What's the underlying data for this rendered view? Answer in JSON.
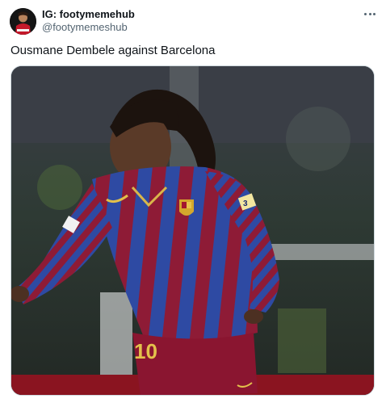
{
  "post": {
    "display_name": "IG: footymemehub",
    "handle": "@footymemeshub",
    "text": "Ousmane Dembele against Barcelona",
    "more_icon": "more-horizontal-icon"
  },
  "media": {
    "kit_number": "10",
    "armband_label": "3"
  },
  "colors": {
    "text_primary": "#0f1419",
    "text_secondary": "#536471",
    "border": "#cfd9de",
    "kit_blue": "#2e4aa3",
    "kit_claret": "#8e1b36"
  }
}
